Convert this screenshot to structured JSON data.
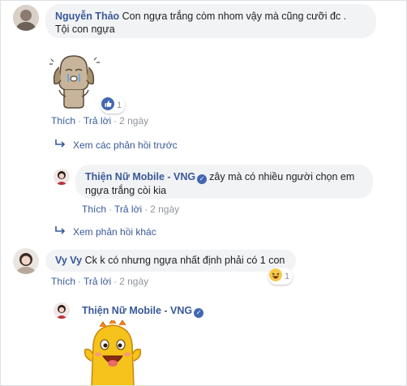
{
  "comments": [
    {
      "author": "Nguyễn Thảo",
      "text_line1": "Con ngựa trắng còm nhom vậy mà cũng cưỡi đc .",
      "text_line2": "Tội con ngựa",
      "reaction": {
        "icon": "like-icon",
        "count": "1"
      },
      "actions": {
        "like": "Thích",
        "reply": "Trả lời",
        "time": "2 ngày"
      }
    },
    {
      "author": "Vy Vy",
      "text": "Ck k có nhưng ngựa nhất định phải có 1 con",
      "reaction": {
        "icon": "haha-icon",
        "count": "1"
      },
      "actions": {
        "like": "Thích",
        "reply": "Trả lời",
        "time": "2 ngày"
      }
    }
  ],
  "replies": [
    {
      "author": "Thiện Nữ Mobile - VNG",
      "text_line1": "zây mà có nhiều người chọn em",
      "text_line2": "ngựa trắng còi kia",
      "actions": {
        "like": "Thích",
        "reply": "Trả lời",
        "time": "2 ngày"
      }
    },
    {
      "author": "Thiện Nữ Mobile - VNG"
    }
  ],
  "links": {
    "previous_replies": "Xem các phản hồi trước",
    "other_replies": "Xem phản hồi khác"
  },
  "colors": {
    "link": "#385898",
    "meta": "#90949c",
    "bubble": "#f2f3f5",
    "verified": "#4267b2"
  }
}
